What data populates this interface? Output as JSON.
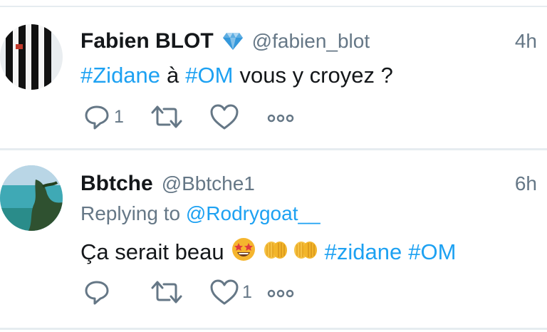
{
  "colors": {
    "link": "#1da1f2",
    "secondary": "#657786",
    "divider": "#e6ecf0",
    "text": "#14171a"
  },
  "tweets": [
    {
      "display_name": "Fabien BLOT",
      "verified_icon": "diamond-emoji",
      "handle": "@fabien_blot",
      "timestamp": "4h",
      "text": {
        "hashtag1": "#Zidane",
        "plain1": "à",
        "hashtag2": "#OM",
        "plain2": "vous y croyez ?"
      },
      "reply_count": "1",
      "retweet_count": "",
      "like_count": ""
    },
    {
      "display_name": "Bbtche",
      "handle": "@Bbtche1",
      "timestamp": "6h",
      "replying_prefix": "Replying to",
      "replying_to": "@Rodrygoat__",
      "text": {
        "plain1": "Ça serait beau",
        "emojis": [
          "star-struck-emoji",
          "clapping-hands-emoji",
          "clapping-hands-emoji"
        ],
        "hashtag1": "#zidane",
        "hashtag2": "#OM"
      },
      "reply_count": "",
      "retweet_count": "",
      "like_count": "1"
    }
  ]
}
